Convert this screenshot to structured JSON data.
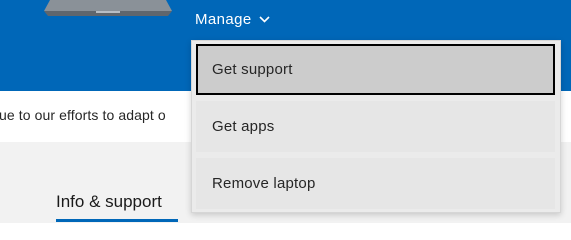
{
  "header": {
    "manage_label": "Manage",
    "background_color": "#0067b8"
  },
  "notice": {
    "text": "ue to our efforts to adapt o"
  },
  "tabs": {
    "active_label": "Info & support"
  },
  "dropdown": {
    "items": [
      {
        "label": "Get support",
        "selected": true
      },
      {
        "label": "Get apps",
        "selected": false
      },
      {
        "label": "Remove laptop",
        "selected": false
      }
    ]
  },
  "icons": {
    "device": "laptop-icon",
    "manage_chevron": "chevron-down-icon"
  }
}
